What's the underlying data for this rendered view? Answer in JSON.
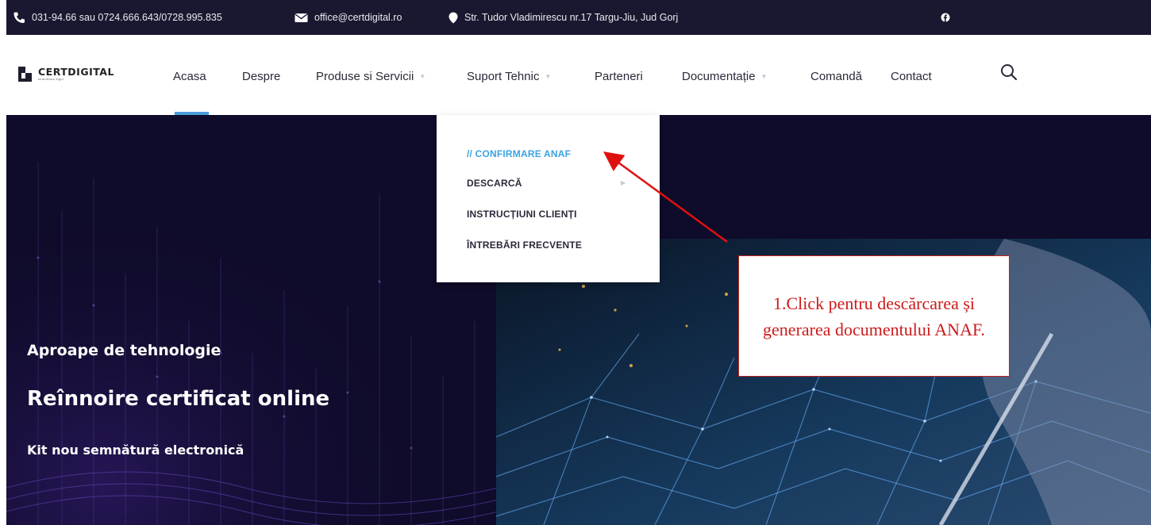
{
  "topbar": {
    "phone": "031-94.66 sau 0724.666.643/0728.995.835",
    "email": "office@certdigital.ro",
    "address": "Str. Tudor Vladimirescu nr.17 Targu-Jiu, Jud Gorj",
    "icons": [
      "phone-icon",
      "envelope-icon",
      "map-pin-icon",
      "facebook-icon"
    ]
  },
  "logo": {
    "name": "CERTDIGITAL",
    "tagline": "semneaza sigur"
  },
  "nav": {
    "items": [
      {
        "label": "Acasa",
        "active": true,
        "dropdown": false
      },
      {
        "label": "Despre",
        "dropdown": false
      },
      {
        "label": "Produse si Servicii",
        "dropdown": true
      },
      {
        "label": "Suport Tehnic",
        "dropdown": true
      },
      {
        "label": "Parteneri",
        "dropdown": false
      },
      {
        "label": "Documentație",
        "dropdown": true
      },
      {
        "label": "Comandă",
        "dropdown": false
      },
      {
        "label": "Contact",
        "dropdown": false
      }
    ],
    "active_color": "#4a9ed8"
  },
  "dropdown": {
    "items": [
      {
        "label": "// CONFIRMARE ANAF",
        "active": true
      },
      {
        "label": "DESCARCĂ",
        "submenu": true
      },
      {
        "label": "INSTRUCȚIUNI CLIENȚI"
      },
      {
        "label": "ÎNTREBĂRI FRECVENTE"
      }
    ],
    "active_color": "#3ba3e0"
  },
  "hero": {
    "line1": "Aproape de tehnologie",
    "line2": "Reînnoire certificat online",
    "line3": "Kit nou semnătură electronică",
    "background_color": "#0f0b2a"
  },
  "annotation": {
    "text": "1.Click pentru descărcarea și generarea documentului ANAF.",
    "color": "#cc1a1a"
  }
}
